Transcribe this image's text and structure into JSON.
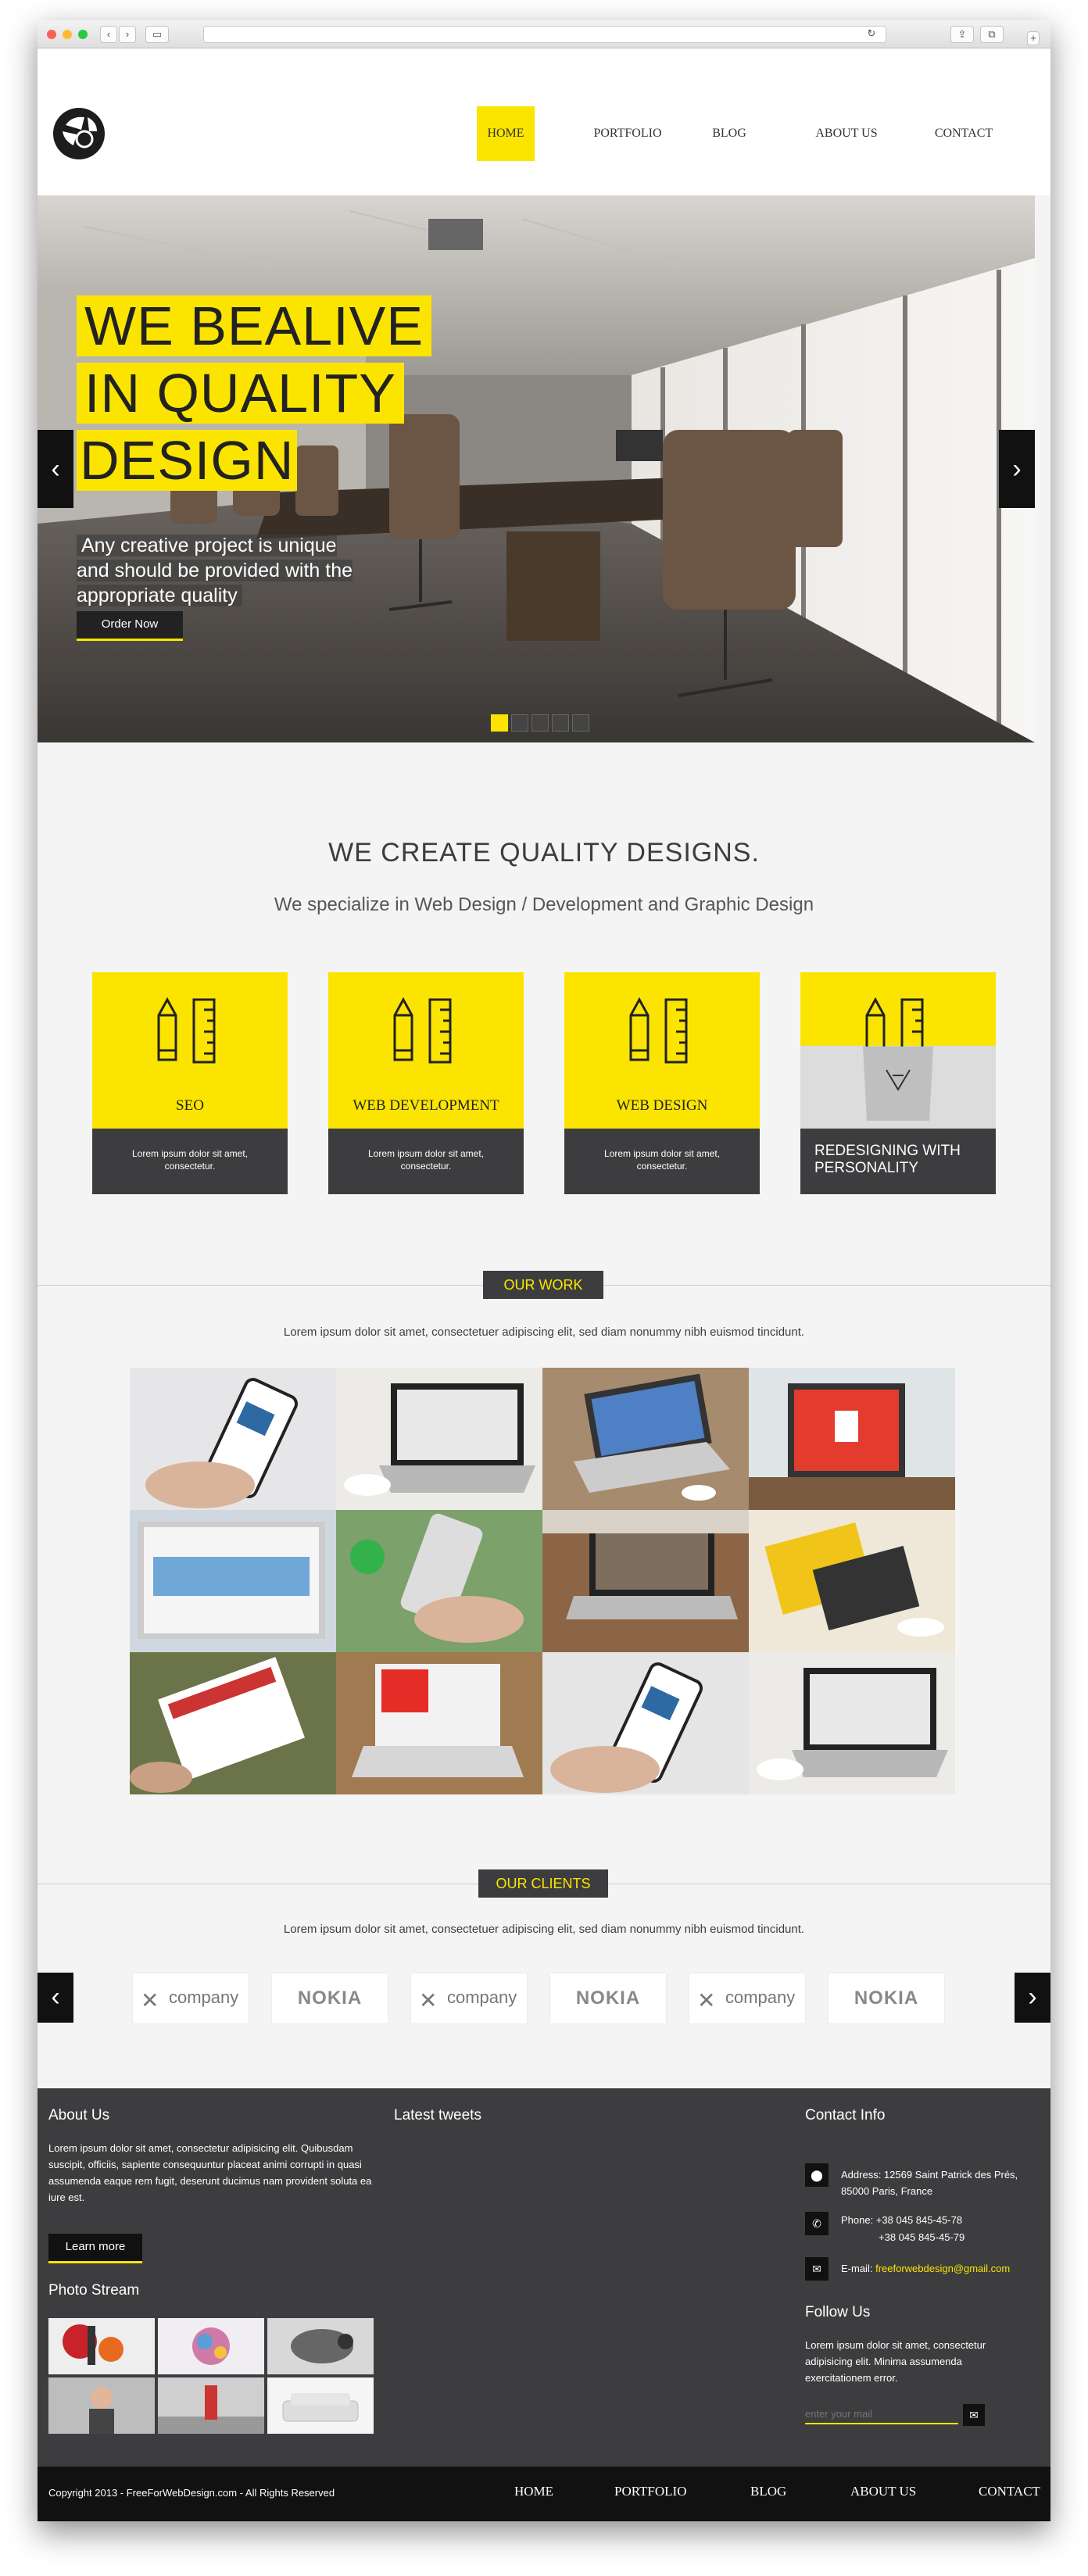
{
  "browser": {
    "url": ""
  },
  "nav": {
    "home": "HOME",
    "portfolio": "PORTFOLIO",
    "blog": "BLOG",
    "about": "ABOUT US",
    "contact": "CONTACT"
  },
  "hero": {
    "line1": "WE BEALIVE",
    "line2": "IN QUALITY",
    "line3": "DESIGN",
    "sub": "Any creative project is unique and should be provided with the appropriate quality",
    "button": "Order Now",
    "prev_icon": "chevron-left-icon",
    "next_icon": "chevron-right-icon",
    "active_slide": 1,
    "slide_count": 5
  },
  "intro": {
    "title": "WE CREATE QUALITY DESIGNS.",
    "subtitle": "We specialize in Web Design / Development and Graphic Design"
  },
  "services": [
    {
      "label": "SEO",
      "text": "Lorem ipsum dolor sit amet, consectetur.",
      "icon": "pencil-ruler-icon"
    },
    {
      "label": "WEB DEVELOPMENT",
      "text": "Lorem ipsum dolor sit amet, consectetur.",
      "icon": "pencil-ruler-icon"
    },
    {
      "label": "WEB DESIGN",
      "text": "Lorem ipsum dolor sit amet, consectetur.",
      "icon": "pencil-ruler-icon"
    },
    {
      "label": "REDESIGNING WITH PERSONALITY",
      "text": "",
      "icon": "pencil-ruler-icon"
    }
  ],
  "work": {
    "tag": "OUR WORK",
    "text": "Lorem ipsum dolor sit amet, consectetuer adipiscing elit, sed diam nonummy nibh euismod tincidunt."
  },
  "clients": {
    "tag": "OUR CLIENTS",
    "text": "Lorem ipsum dolor sit amet, consectetuer adipiscing elit, sed diam nonummy nibh euismod tincidunt.",
    "logos": [
      "company",
      "NOKIA",
      "company",
      "NOKIA",
      "company",
      "NOKIA"
    ]
  },
  "footer": {
    "about_title": "About Us",
    "about_text": "Lorem ipsum dolor sit amet, consectetur adipisicing elit. Quibusdam suscipit, officiis, sapiente consequuntur placeat animi corrupti in quasi assumenda eaque rem fugit, deserunt ducimus nam provident soluta ea iure est.",
    "learn_more": "Learn more",
    "photo_title": "Photo Stream",
    "tweets_title": "Latest tweets",
    "contact_title": "Contact Info",
    "address": "Address: 12569 Saint Patrick des Prés, 85000 Paris, France",
    "phone1": "Phone: +38 045 845-45-78",
    "phone2": "+38 045 845-45-79",
    "email_label": "E-mail:",
    "email": "freeforwebdesign@gmail.com",
    "follow_title": "Follow Us",
    "follow_text": "Lorem ipsum dolor sit amet, consectetur adipisicing elit. Minima assumenda exercitationem error.",
    "mail_placeholder": "enter your mail"
  },
  "bottom": {
    "copyright": "Copyright 2013 - FreeForWebDesign.com - All Rights Reserved"
  },
  "colors": {
    "accent": "#fbe500",
    "dark": "#3d3d3f",
    "black": "#111111"
  }
}
